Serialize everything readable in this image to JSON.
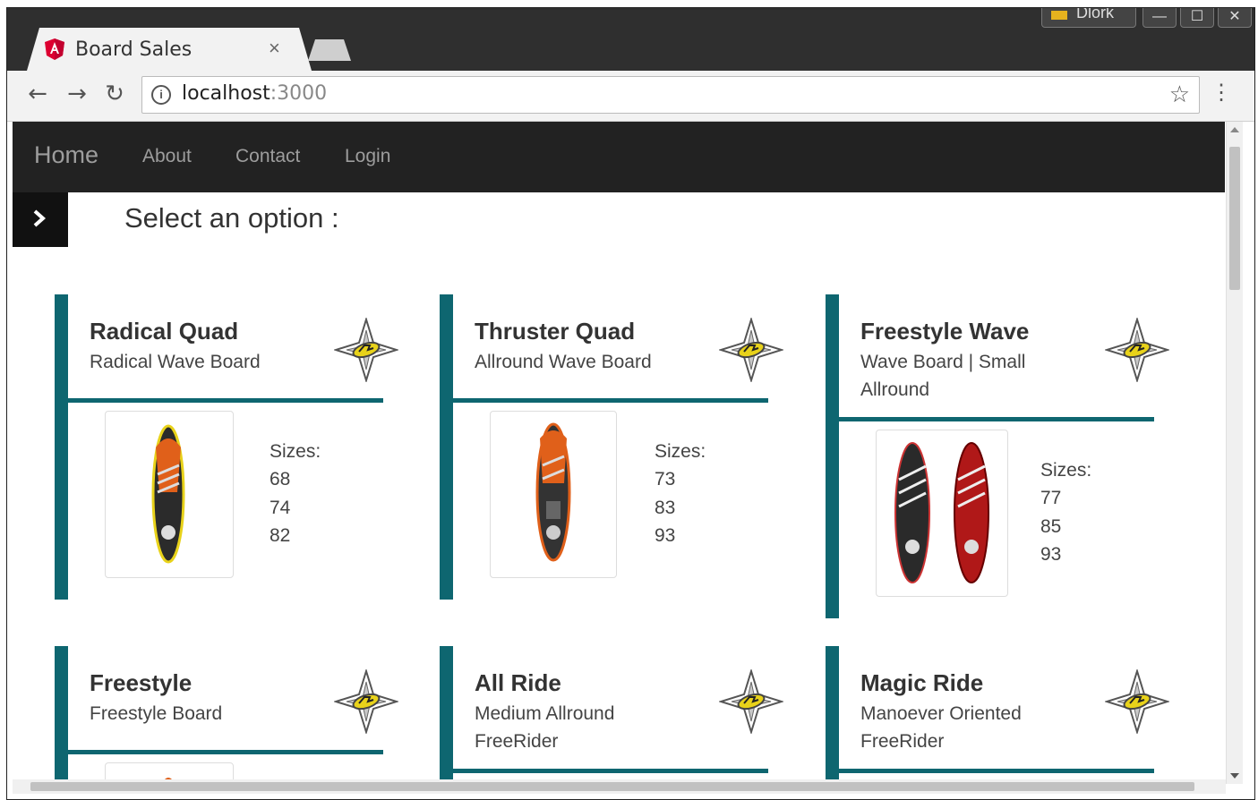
{
  "browser": {
    "tab_title": "Board Sales",
    "tab_close": "×",
    "profile_label": "Dlork",
    "window_controls": [
      "—",
      "☐",
      "✕"
    ],
    "url_host": "localhost",
    "url_port": ":3000",
    "nav_icons": [
      "back-arrow-icon",
      "forward-arrow-icon",
      "reload-icon",
      "info-icon",
      "star-icon",
      "menu-dots-icon"
    ],
    "accent_favicon_color": "#dd0031"
  },
  "navbar": {
    "brand": "Home",
    "links": [
      "About",
      "Contact",
      "Login"
    ]
  },
  "page": {
    "select_title": "Select an option :",
    "accent_color": "#0e6670"
  },
  "boards": [
    {
      "name": "Radical Quad",
      "description": "Radical Wave Board",
      "sizes_label": "Sizes:",
      "sizes": [
        "68",
        "74",
        "82"
      ]
    },
    {
      "name": "Thruster Quad",
      "description": "Allround Wave Board",
      "sizes_label": "Sizes:",
      "sizes": [
        "73",
        "83",
        "93"
      ]
    },
    {
      "name": "Freestyle Wave",
      "description": "Wave Board | Small Allround",
      "sizes_label": "Sizes:",
      "sizes": [
        "77",
        "85",
        "93"
      ]
    },
    {
      "name": "Freestyle",
      "description": "Freestyle Board"
    },
    {
      "name": "All Ride",
      "description": "Medium Allround FreeRider"
    },
    {
      "name": "Magic Ride",
      "description": "Manoever Oriented FreeRider"
    }
  ]
}
